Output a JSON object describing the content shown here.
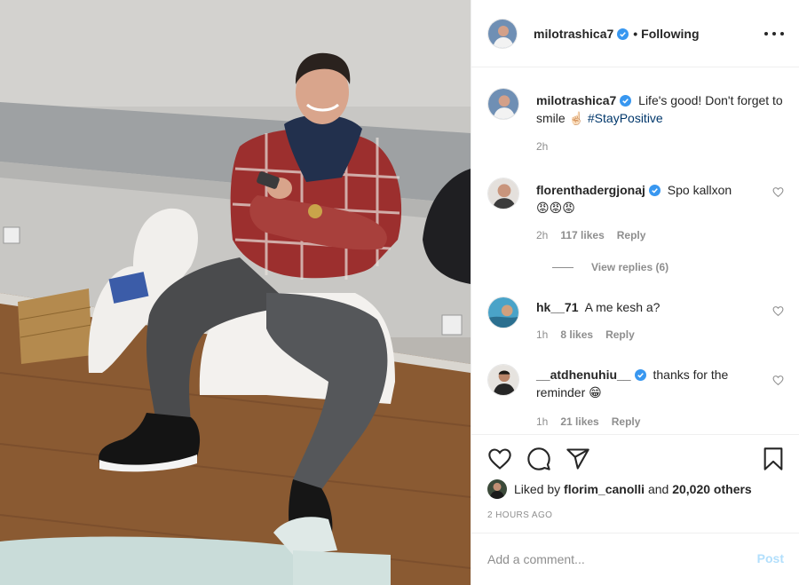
{
  "post": {
    "username": "milotrashica7",
    "follow_status": "Following",
    "caption_text": "Life's good! Don't forget to smile ☝🏻",
    "caption_hashtag": "#StayPositive",
    "caption_time": "2h"
  },
  "comments": [
    {
      "username": "florenthadergjonaj",
      "verified": true,
      "text": "Spo kallxon",
      "emoji": "😡😡😡",
      "time": "2h",
      "likes": "117 likes",
      "reply": "Reply",
      "view_replies": "View replies (6)"
    },
    {
      "username": "hk__71",
      "verified": false,
      "text": "A me kesh a?",
      "time": "1h",
      "likes": "8 likes",
      "reply": "Reply"
    },
    {
      "username": "__atdhenuhiu__",
      "verified": true,
      "text": "thanks for the reminder",
      "emoji": "😁",
      "time": "1h",
      "likes": "21 likes",
      "reply": "Reply"
    }
  ],
  "likes": {
    "prefix": "Liked by",
    "user": "florim_canolli",
    "joiner": "and",
    "others": "20,020 others"
  },
  "time_ago": "2 HOURS AGO",
  "add_comment": {
    "placeholder": "Add a comment...",
    "post_label": "Post"
  },
  "icons": {
    "heart": "heart-icon",
    "comment": "comment-icon",
    "share": "share-icon",
    "save": "bookmark-icon",
    "more": "more-options-icon"
  },
  "colors": {
    "verified": "#3897f0",
    "link": "#00376b",
    "post_disabled": "#b2dffc",
    "muted": "#8e8e8e"
  }
}
